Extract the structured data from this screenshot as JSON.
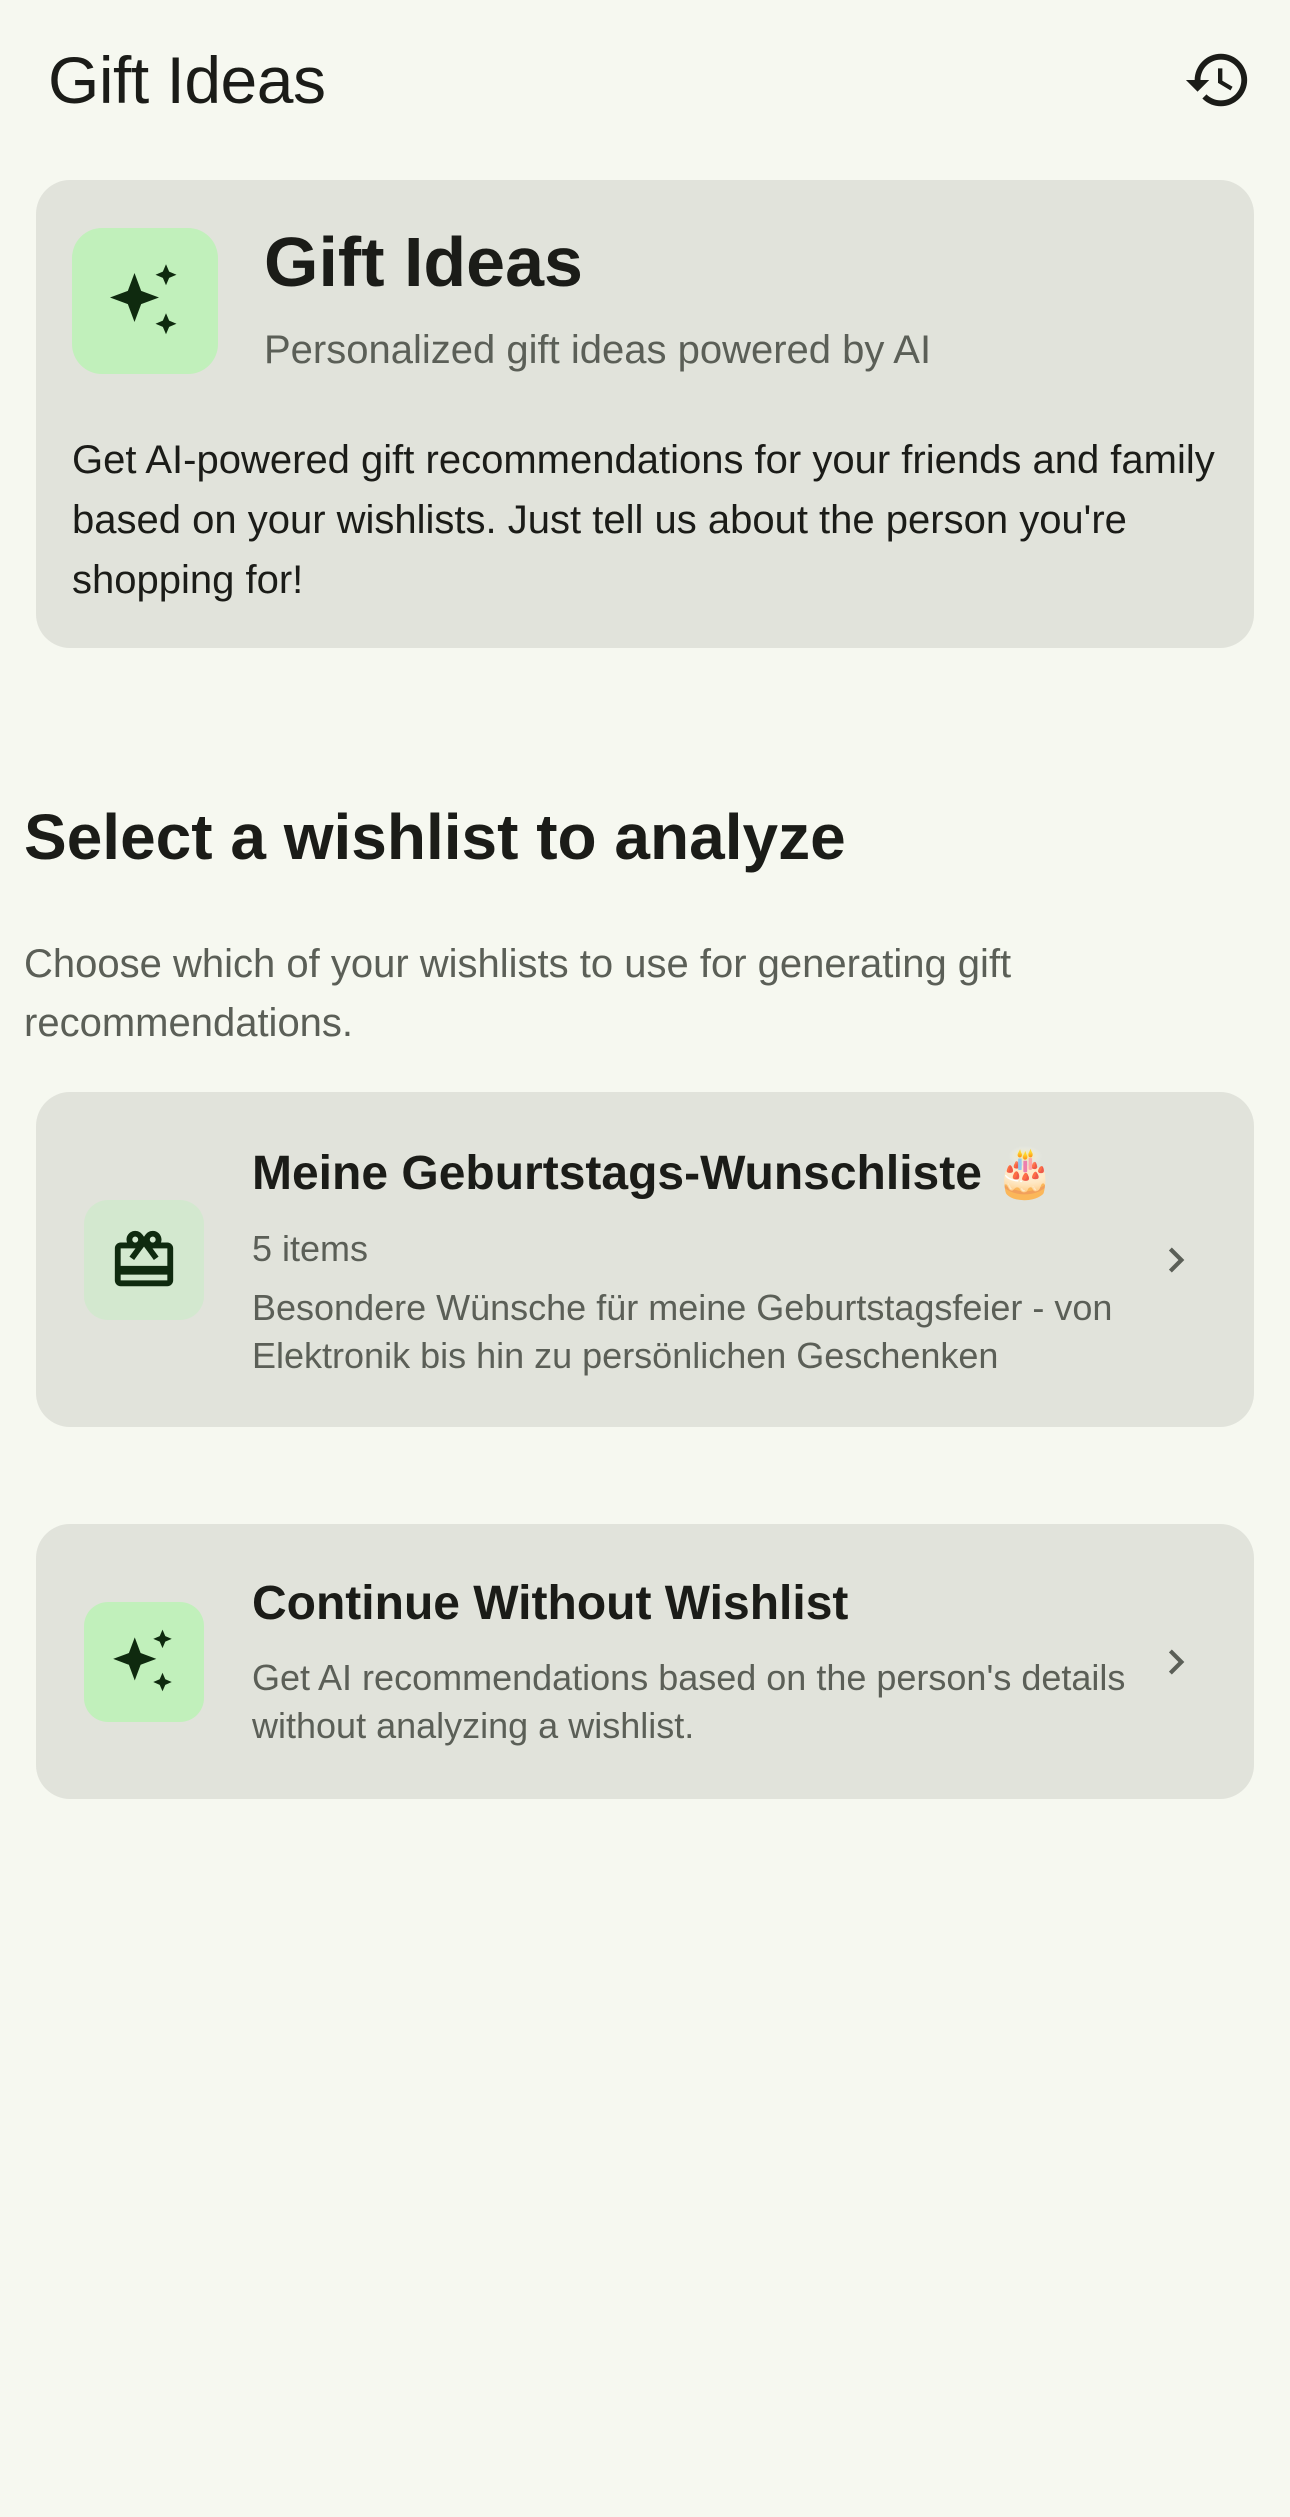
{
  "app_bar": {
    "title": "Gift Ideas",
    "history_icon": "history-icon"
  },
  "intro_card": {
    "icon": "sparkles-icon",
    "title": "Gift Ideas",
    "subtitle": "Personalized gift ideas powered by AI",
    "description": "Get AI-powered gift recommendations for your friends and family based on your wishlists. Just tell us about the person you're shopping for!"
  },
  "section": {
    "heading": "Select a wishlist to analyze",
    "description": "Choose which of your wishlists to use for generating gift recommendations."
  },
  "wishlists": [
    {
      "icon": "gift-card-icon",
      "title": "Meine Geburtstags-Wunschliste 🎂",
      "count": "5 items",
      "description": "Besondere Wünsche für meine Geburtstagsfeier - von Elektronik bis hin zu persönlichen Geschenken"
    }
  ],
  "continue_option": {
    "icon": "sparkles-icon",
    "title": "Continue Without Wishlist",
    "description": "Get AI recommendations based on the person's details without analyzing a wishlist."
  },
  "colors": {
    "background": "#f6f8f0",
    "card": "#e1e3db",
    "accent_container": "#c1f0bb",
    "on_accent": "#0f2a0f",
    "muted_text": "#5b5f57"
  }
}
